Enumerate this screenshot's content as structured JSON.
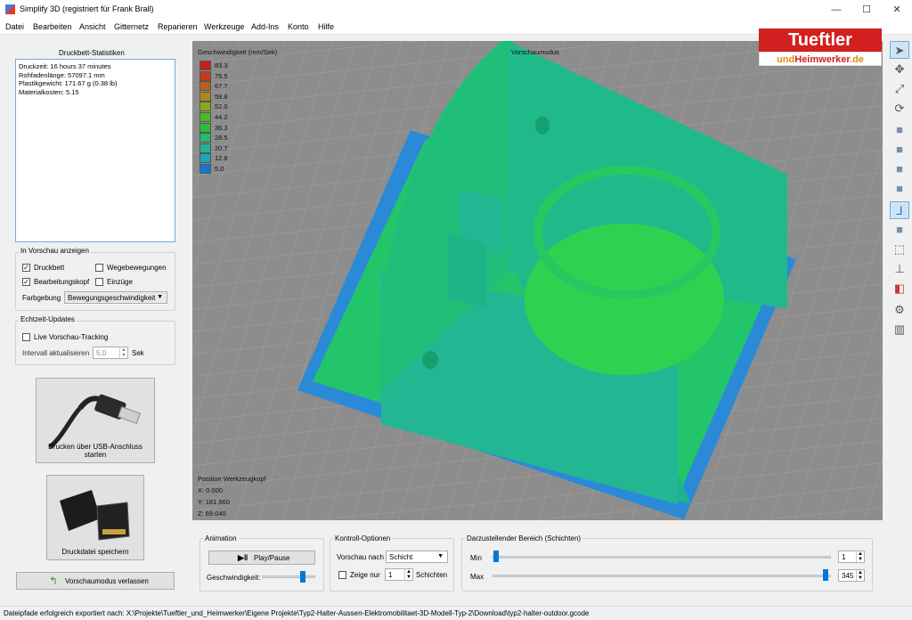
{
  "window": {
    "title": "Simplify 3D (registriert für Frank Brall)",
    "minimize": "—",
    "maximize": "☐",
    "close": "✕"
  },
  "menu": [
    "Datei",
    "Bearbeiten",
    "Ansicht",
    "Gitternetz",
    "Reparieren",
    "Werkzeuge",
    "Add-Ins",
    "Konto",
    "Hilfe"
  ],
  "stats": {
    "title": "Druckbett-Statistiken",
    "lines": [
      "Druckzeit: 16 hours 37 minutes",
      "Rohfadenlänge: 57097.1 mm",
      "Plastikgewicht: 171.67 g (0.38 lb)",
      "Materialkosten: 5.15"
    ]
  },
  "preview": {
    "title": "In Vorschau anzeigen",
    "druckbett": "Druckbett",
    "wegebewegungen": "Wegebewegungen",
    "bearbeitungskopf": "Bearbeitungskopf",
    "einzuege": "Einzüge",
    "farbgebung_label": "Farbgebung",
    "farbgebung_value": "Bewegungsgeschwindigkeit",
    "check": "✓"
  },
  "realtime": {
    "title": "Echtzeit-Updates",
    "live": "Live Vorschau-Tracking",
    "interval_label": "Intervall aktualisieren",
    "interval_value": "5,0",
    "interval_unit": "Sek"
  },
  "usb_button": "Drucken über USB-Anschluss starten",
  "save_button": "Druckdatei speichern",
  "exit_button": "Vorschaumodus verlassen",
  "viewport": {
    "legend_title": "Geschwindigkeit (mm/Sek)",
    "legend": [
      {
        "value": "83.3",
        "color": "#c81e1e"
      },
      {
        "value": "75.5",
        "color": "#c43c1c"
      },
      {
        "value": "67.7",
        "color": "#b8601a"
      },
      {
        "value": "59.8",
        "color": "#a88a18"
      },
      {
        "value": "52.0",
        "color": "#8aa81a"
      },
      {
        "value": "44.2",
        "color": "#4fb52a"
      },
      {
        "value": "36.3",
        "color": "#2ebd3a"
      },
      {
        "value": "28.5",
        "color": "#22bd6a"
      },
      {
        "value": "20.7",
        "color": "#20b594"
      },
      {
        "value": "12.8",
        "color": "#1aa6b8"
      },
      {
        "value": "5.0",
        "color": "#1676d0"
      }
    ],
    "mode": "Vorschaumodus",
    "pos_title": "Position Werkzeugkopf",
    "x": "X: 0.000",
    "y": "Y: 181.560",
    "z": "Z: 69.040"
  },
  "logo": {
    "line1": "Tueftler",
    "line2a": "und",
    "line2b": "Heimwerker",
    "line2c": ".de"
  },
  "animation": {
    "title": "Animation",
    "play": "Play/Pause",
    "speed_label": "Geschwindigkeit:",
    "speed_level": 0.8
  },
  "control": {
    "title": "Kontroll-Optionen",
    "vorschau_label": "Vorschau nach",
    "vorschau_value": "Schicht",
    "zeige_label": "Zeige nur",
    "zeige_value": "1",
    "schichten": "Schichten"
  },
  "range": {
    "title": "Darzustellender Bereich (Schichten)",
    "min_label": "Min",
    "min_value": "1",
    "max_label": "Max",
    "max_value": "345"
  },
  "status": "Dateipfade erfolgreich exportiert nach: X:\\Projekte\\Tueftler_und_Heimwerker\\Eigene Projekte\\Typ2-Halter-Aussen-Elektromobilitaet-3D-Modell-Typ-2\\Download\\typ2-halter-outdoor.gcode"
}
